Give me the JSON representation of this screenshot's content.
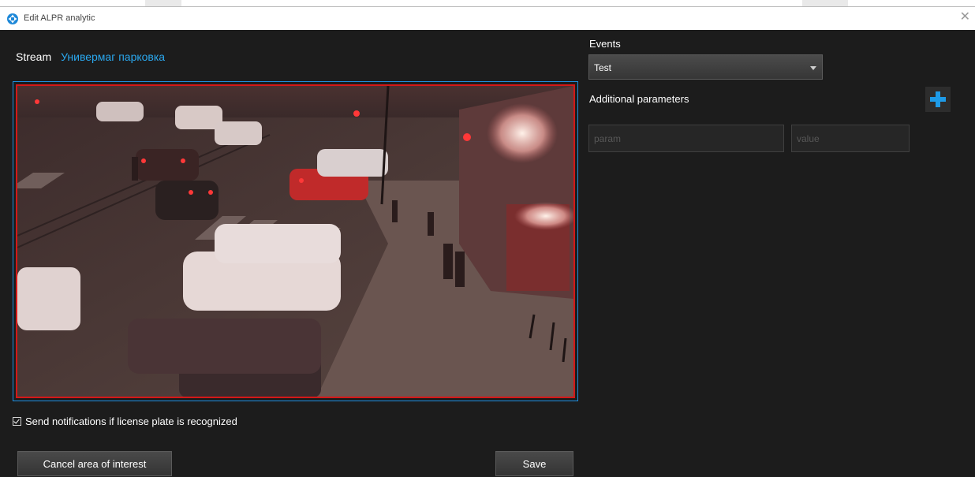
{
  "window": {
    "title": "Edit ALPR analytic",
    "app_icon": "alpr-app-icon",
    "close_icon": "close-icon"
  },
  "stream": {
    "label": "Stream",
    "name": "Универмаг парковка"
  },
  "notifications": {
    "label": "Send notifications if license plate is recognized",
    "checked": true
  },
  "buttons": {
    "cancel_area": "Cancel area of interest",
    "save": "Save"
  },
  "events": {
    "label": "Events",
    "selected": "Test"
  },
  "additional_parameters": {
    "label": "Additional parameters",
    "add_icon": "plus-icon",
    "param_placeholder": "param",
    "value_placeholder": "value"
  },
  "colors": {
    "accent_blue": "#2aa8ef",
    "roi_border": "#d41818",
    "dialog_bg": "#1c1c1c"
  }
}
